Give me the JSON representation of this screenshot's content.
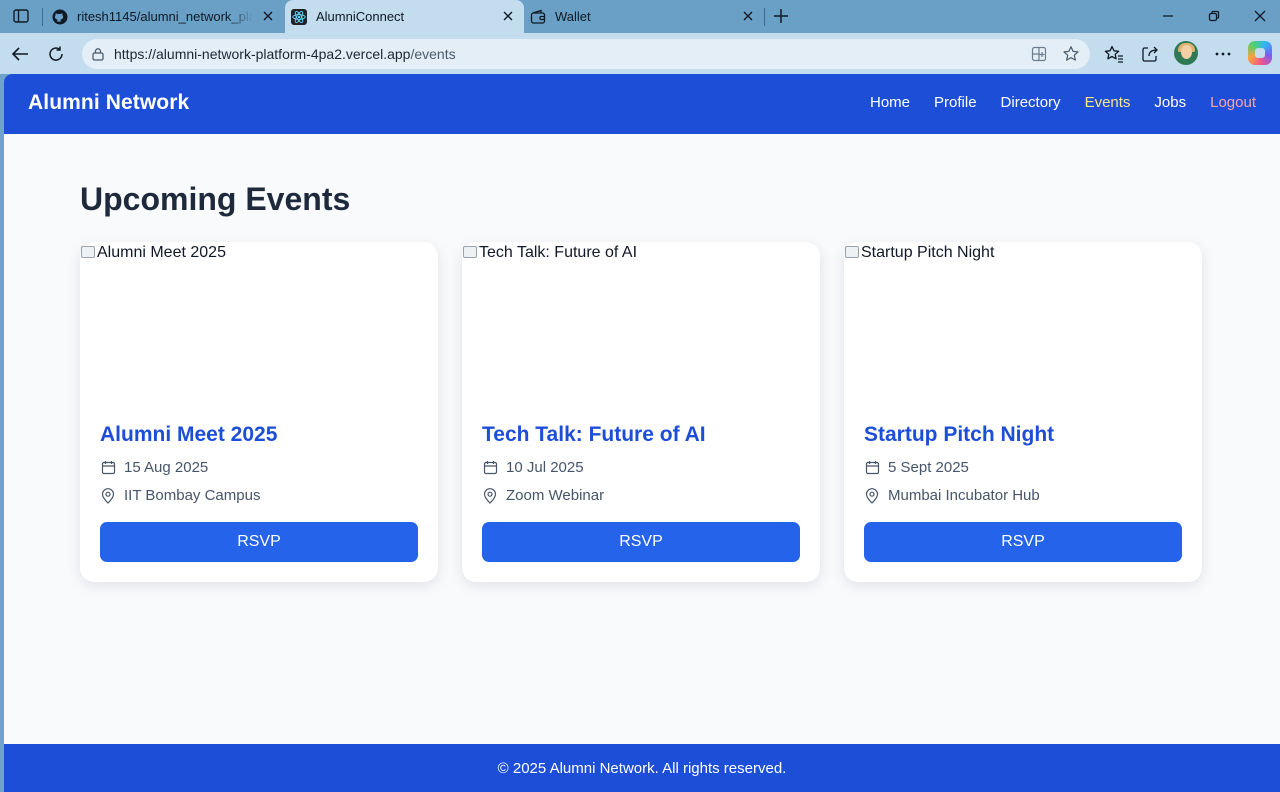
{
  "browser": {
    "tabs": [
      {
        "title": "ritesh1145/alumni_network_platform",
        "favicon": "github-icon"
      },
      {
        "title": "AlumniConnect",
        "favicon": "react-icon",
        "active": true
      },
      {
        "title": "Wallet",
        "favicon": "wallet-icon"
      }
    ],
    "address": {
      "host": "https://alumni-network-platform-4pa2.vercel.app",
      "path": "/events"
    }
  },
  "site": {
    "brand": "Alumni Network",
    "nav": {
      "home": "Home",
      "profile": "Profile",
      "directory": "Directory",
      "events": "Events",
      "jobs": "Jobs",
      "logout": "Logout"
    },
    "page_title": "Upcoming Events",
    "events": [
      {
        "image_alt": "Alumni Meet 2025",
        "title": "Alumni Meet 2025",
        "date": "15 Aug 2025",
        "location": "IIT Bombay Campus",
        "button": "RSVP"
      },
      {
        "image_alt": "Tech Talk: Future of AI",
        "title": "Tech Talk: Future of AI",
        "date": "10 Jul 2025",
        "location": "Zoom Webinar",
        "button": "RSVP"
      },
      {
        "image_alt": "Startup Pitch Night",
        "title": "Startup Pitch Night",
        "date": "5 Sept 2025",
        "location": "Mumbai Incubator Hub",
        "button": "RSVP"
      }
    ],
    "footer": "© 2025 Alumni Network. All rights reserved."
  },
  "colors": {
    "brand_blue": "#1d4ed8",
    "button_blue": "#2563eb",
    "active_nav": "#fde68a",
    "logout": "#fca5a5",
    "page_bg": "#f8fafc"
  }
}
